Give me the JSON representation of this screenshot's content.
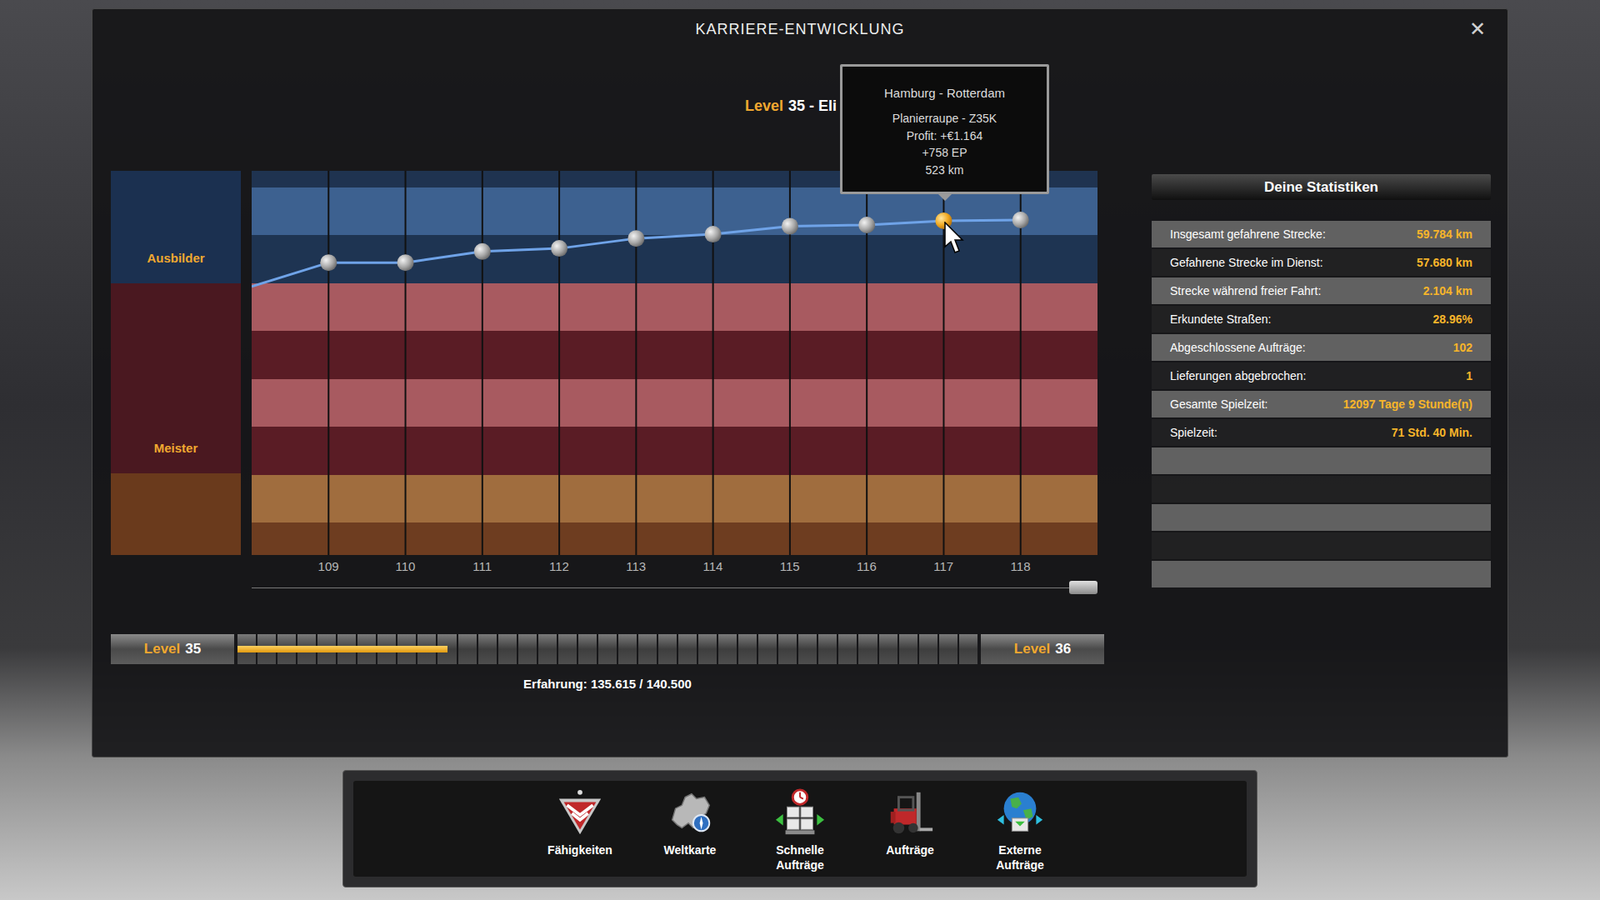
{
  "window": {
    "title": "KARRIERE-ENTWICKLUNG",
    "close": "✕"
  },
  "level_heading": {
    "label": "Level",
    "value": "35 - Eli"
  },
  "chart": {
    "ranks": [
      {
        "label": "Ausbilder",
        "color": "#1b3050"
      },
      {
        "label": "Meister",
        "color": "#4a1820"
      },
      {
        "label": "",
        "color": "#6a3a1c"
      }
    ],
    "stripes": [
      {
        "color": "#1f3350"
      },
      {
        "color": "#3d6190"
      },
      {
        "color": "#1e3452"
      },
      {
        "color": "#a85a60"
      },
      {
        "color": "#5a1c25"
      },
      {
        "color": "#a85a60"
      },
      {
        "color": "#5a1c25"
      },
      {
        "color": "#a06d3e"
      },
      {
        "color": "#6e3d20"
      }
    ],
    "lead_in_value": 69.9,
    "points": [
      {
        "label": "109",
        "value": 76.1,
        "selected": false
      },
      {
        "label": "110",
        "value": 76.1,
        "selected": false
      },
      {
        "label": "111",
        "value": 79.0,
        "selected": false
      },
      {
        "label": "112",
        "value": 79.8,
        "selected": false
      },
      {
        "label": "113",
        "value": 82.4,
        "selected": false
      },
      {
        "label": "114",
        "value": 83.5,
        "selected": false
      },
      {
        "label": "115",
        "value": 85.6,
        "selected": false
      },
      {
        "label": "116",
        "value": 85.9,
        "selected": false
      },
      {
        "label": "117",
        "value": 87.0,
        "selected": true
      },
      {
        "label": "118",
        "value": 87.2,
        "selected": false
      }
    ],
    "scrollbar": {
      "level": 1
    }
  },
  "tooltip": {
    "title": "Hamburg - Rotterdam",
    "lines": [
      "Planierraupe - Z35K",
      "Profit: +€1.164",
      "+758 EP",
      "523 km"
    ]
  },
  "progress": {
    "from": {
      "label": "Level",
      "number": "35"
    },
    "to": {
      "label": "Level",
      "number": "36"
    },
    "level": 0.284
  },
  "experience": "Erfahrung: 135.615 / 140.500",
  "stats": {
    "title": "Deine Statistiken",
    "rows": [
      {
        "label": "Insgesamt gefahrene Strecke:",
        "value": "59.784 km"
      },
      {
        "label": "Gefahrene Strecke im Dienst:",
        "value": "57.680 km"
      },
      {
        "label": "Strecke während freier Fahrt:",
        "value": "2.104 km"
      },
      {
        "label": "Erkundete Straßen:",
        "value": "28.96%"
      },
      {
        "label": "Abgeschlossene Aufträge:",
        "value": "102"
      },
      {
        "label": "Lieferungen abgebrochen:",
        "value": "1"
      },
      {
        "label": "Gesamte Spielzeit:",
        "value": "12097 Tage 9 Stunde(n)"
      },
      {
        "label": "Spielzeit:",
        "value": "71 Std. 40 Min."
      }
    ]
  },
  "toolbar": [
    {
      "label": "Fähigkeiten",
      "kind": "skills"
    },
    {
      "label": "Weltkarte",
      "kind": "map"
    },
    {
      "label": "Schnelle Aufträge",
      "kind": "quick"
    },
    {
      "label": "Aufträge",
      "kind": "jobs"
    },
    {
      "label": "Externe Aufträge",
      "kind": "external"
    }
  ]
}
